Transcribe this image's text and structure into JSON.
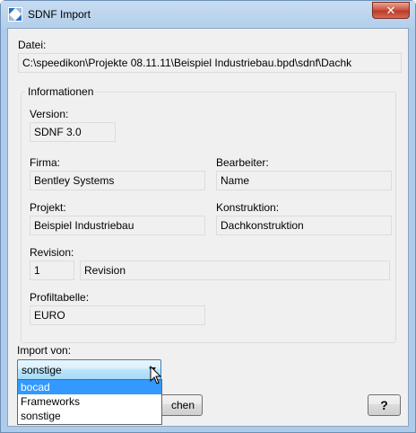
{
  "window": {
    "title": "SDNF Import",
    "close_glyph": "✕"
  },
  "datei": {
    "label": "Datei:",
    "value": "C:\\speedikon\\Projekte 08.11.11\\Beispiel Industriebau.bpd\\sdnf\\Dachk"
  },
  "info": {
    "title": "Informationen",
    "version_label": "Version:",
    "version_value": "SDNF 3.0",
    "firma_label": "Firma:",
    "firma_value": "Bentley Systems",
    "bearbeiter_label": "Bearbeiter:",
    "bearbeiter_value": "Name",
    "projekt_label": "Projekt:",
    "projekt_value": "Beispiel Industriebau",
    "konstruktion_label": "Konstruktion:",
    "konstruktion_value": "Dachkonstruktion",
    "revision_label": "Revision:",
    "revision_number": "1",
    "revision_text": "Revision",
    "profiltabelle_label": "Profiltabelle:",
    "profiltabelle_value": "EURO"
  },
  "import": {
    "label": "Import von:",
    "selected": "sonstige",
    "options": [
      "bocad",
      "Frameworks",
      "sonstige"
    ],
    "highlighted": "bocad"
  },
  "buttons": {
    "cancel_partial": "chen",
    "help": "?"
  }
}
